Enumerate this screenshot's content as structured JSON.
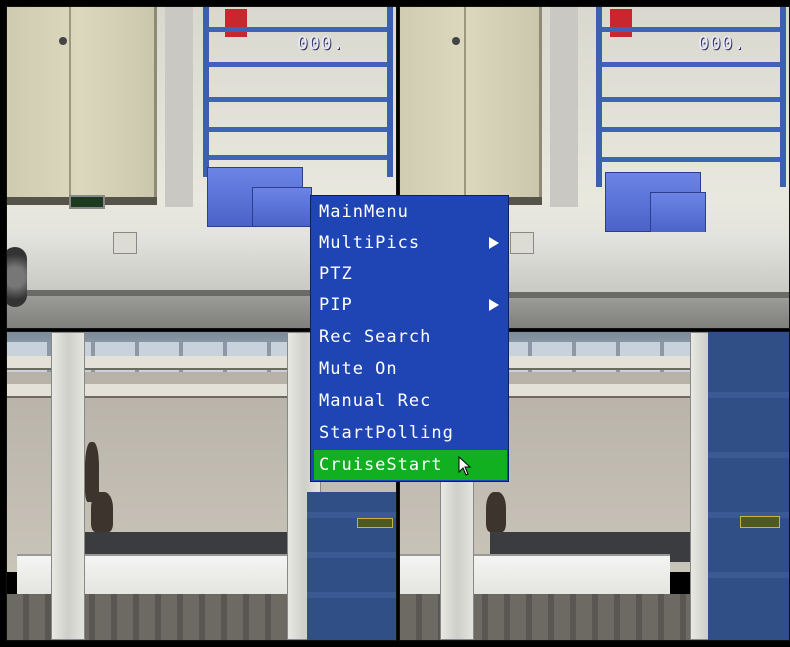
{
  "screen": {
    "channels": [
      {
        "label": "000."
      },
      {
        "label": "000."
      },
      {
        "label": ""
      },
      {
        "label": ""
      }
    ]
  },
  "menu": {
    "items": [
      {
        "label": "MainMenu",
        "submenu": false,
        "selected": false
      },
      {
        "label": "MultiPics",
        "submenu": true,
        "selected": false
      },
      {
        "label": "PTZ",
        "submenu": false,
        "selected": false
      },
      {
        "label": "PIP",
        "submenu": true,
        "selected": false
      },
      {
        "label": "Rec Search",
        "submenu": false,
        "selected": false
      },
      {
        "label": "Mute On",
        "submenu": false,
        "selected": false
      },
      {
        "label": "Manual Rec",
        "submenu": false,
        "selected": false
      },
      {
        "label": "StartPolling",
        "submenu": false,
        "selected": false
      },
      {
        "label": "CruiseStart",
        "submenu": false,
        "selected": true
      }
    ]
  },
  "icons": {
    "submenu_arrow": "arrow-right-icon",
    "cursor": "mouse-pointer-icon"
  },
  "colors": {
    "menu_bg": "#1f45b5",
    "menu_text": "#ffffff",
    "selected_bg": "#10b020",
    "camera_number": "#e8e8ff"
  }
}
